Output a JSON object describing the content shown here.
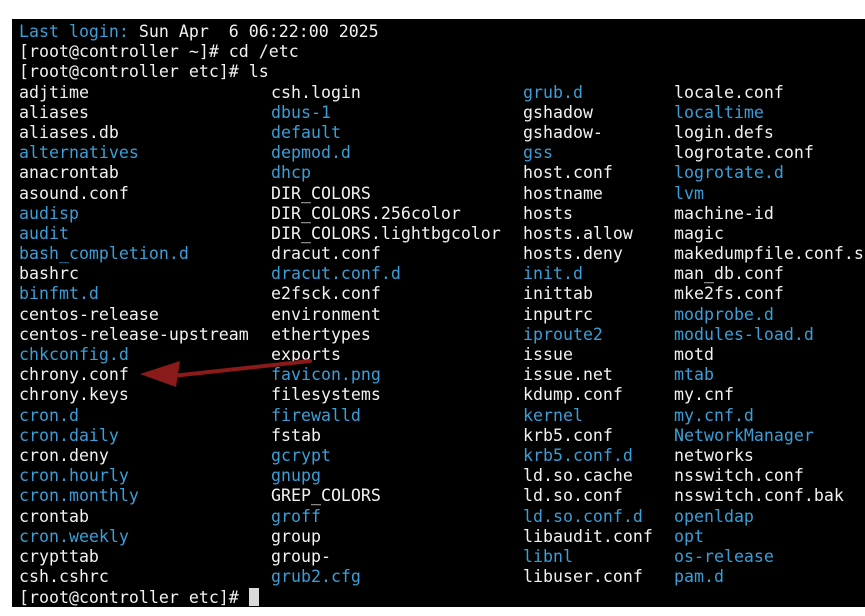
{
  "terminal": {
    "last_login_label": "Last login:",
    "last_login_value": " Sun Apr  6 06:22:00 2025",
    "cmd1": "[root@controller ~]# cd /etc",
    "cmd2": "[root@controller etc]# ls",
    "prompt_final": "[root@controller etc]# ",
    "columns": [
      [
        {
          "name": "adjtime",
          "type": "file"
        },
        {
          "name": "aliases",
          "type": "file"
        },
        {
          "name": "aliases.db",
          "type": "file"
        },
        {
          "name": "alternatives",
          "type": "dir"
        },
        {
          "name": "anacrontab",
          "type": "file"
        },
        {
          "name": "asound.conf",
          "type": "file"
        },
        {
          "name": "audisp",
          "type": "dir"
        },
        {
          "name": "audit",
          "type": "dir"
        },
        {
          "name": "bash_completion.d",
          "type": "dir"
        },
        {
          "name": "bashrc",
          "type": "file"
        },
        {
          "name": "binfmt.d",
          "type": "dir"
        },
        {
          "name": "centos-release",
          "type": "file"
        },
        {
          "name": "centos-release-upstream",
          "type": "file"
        },
        {
          "name": "chkconfig.d",
          "type": "dir"
        },
        {
          "name": "chrony.conf",
          "type": "file"
        },
        {
          "name": "chrony.keys",
          "type": "file"
        },
        {
          "name": "cron.d",
          "type": "dir"
        },
        {
          "name": "cron.daily",
          "type": "dir"
        },
        {
          "name": "cron.deny",
          "type": "file"
        },
        {
          "name": "cron.hourly",
          "type": "dir"
        },
        {
          "name": "cron.monthly",
          "type": "dir"
        },
        {
          "name": "crontab",
          "type": "file"
        },
        {
          "name": "cron.weekly",
          "type": "dir"
        },
        {
          "name": "crypttab",
          "type": "file"
        },
        {
          "name": "csh.cshrc",
          "type": "file"
        }
      ],
      [
        {
          "name": "csh.login",
          "type": "file"
        },
        {
          "name": "dbus-1",
          "type": "dir"
        },
        {
          "name": "default",
          "type": "dir"
        },
        {
          "name": "depmod.d",
          "type": "dir"
        },
        {
          "name": "dhcp",
          "type": "dir"
        },
        {
          "name": "DIR_COLORS",
          "type": "file"
        },
        {
          "name": "DIR_COLORS.256color",
          "type": "file"
        },
        {
          "name": "DIR_COLORS.lightbgcolor",
          "type": "file"
        },
        {
          "name": "dracut.conf",
          "type": "file"
        },
        {
          "name": "dracut.conf.d",
          "type": "dir"
        },
        {
          "name": "e2fsck.conf",
          "type": "file"
        },
        {
          "name": "environment",
          "type": "file"
        },
        {
          "name": "ethertypes",
          "type": "file"
        },
        {
          "name": "exports",
          "type": "file"
        },
        {
          "name": "favicon.png",
          "type": "dir"
        },
        {
          "name": "filesystems",
          "type": "file"
        },
        {
          "name": "firewalld",
          "type": "dir"
        },
        {
          "name": "fstab",
          "type": "file"
        },
        {
          "name": "gcrypt",
          "type": "dir"
        },
        {
          "name": "gnupg",
          "type": "dir"
        },
        {
          "name": "GREP_COLORS",
          "type": "file"
        },
        {
          "name": "groff",
          "type": "dir"
        },
        {
          "name": "group",
          "type": "file"
        },
        {
          "name": "group-",
          "type": "file"
        },
        {
          "name": "grub2.cfg",
          "type": "dir"
        }
      ],
      [
        {
          "name": "grub.d",
          "type": "dir"
        },
        {
          "name": "gshadow",
          "type": "file"
        },
        {
          "name": "gshadow-",
          "type": "file"
        },
        {
          "name": "gss",
          "type": "dir"
        },
        {
          "name": "host.conf",
          "type": "file"
        },
        {
          "name": "hostname",
          "type": "file"
        },
        {
          "name": "hosts",
          "type": "file"
        },
        {
          "name": "hosts.allow",
          "type": "file"
        },
        {
          "name": "hosts.deny",
          "type": "file"
        },
        {
          "name": "init.d",
          "type": "dir"
        },
        {
          "name": "inittab",
          "type": "file"
        },
        {
          "name": "inputrc",
          "type": "file"
        },
        {
          "name": "iproute2",
          "type": "dir"
        },
        {
          "name": "issue",
          "type": "file"
        },
        {
          "name": "issue.net",
          "type": "file"
        },
        {
          "name": "kdump.conf",
          "type": "file"
        },
        {
          "name": "kernel",
          "type": "dir"
        },
        {
          "name": "krb5.conf",
          "type": "file"
        },
        {
          "name": "krb5.conf.d",
          "type": "dir"
        },
        {
          "name": "ld.so.cache",
          "type": "file"
        },
        {
          "name": "ld.so.conf",
          "type": "file"
        },
        {
          "name": "ld.so.conf.d",
          "type": "dir"
        },
        {
          "name": "libaudit.conf",
          "type": "file"
        },
        {
          "name": "libnl",
          "type": "dir"
        },
        {
          "name": "libuser.conf",
          "type": "file"
        }
      ],
      [
        {
          "name": "locale.conf",
          "type": "file"
        },
        {
          "name": "localtime",
          "type": "dir"
        },
        {
          "name": "login.defs",
          "type": "file"
        },
        {
          "name": "logrotate.conf",
          "type": "file"
        },
        {
          "name": "logrotate.d",
          "type": "dir"
        },
        {
          "name": "lvm",
          "type": "dir"
        },
        {
          "name": "machine-id",
          "type": "file"
        },
        {
          "name": "magic",
          "type": "file"
        },
        {
          "name": "makedumpfile.conf.s",
          "type": "file"
        },
        {
          "name": "man_db.conf",
          "type": "file"
        },
        {
          "name": "mke2fs.conf",
          "type": "file"
        },
        {
          "name": "modprobe.d",
          "type": "dir"
        },
        {
          "name": "modules-load.d",
          "type": "dir"
        },
        {
          "name": "motd",
          "type": "file"
        },
        {
          "name": "mtab",
          "type": "dir"
        },
        {
          "name": "my.cnf",
          "type": "file"
        },
        {
          "name": "my.cnf.d",
          "type": "dir"
        },
        {
          "name": "NetworkManager",
          "type": "dir"
        },
        {
          "name": "networks",
          "type": "file"
        },
        {
          "name": "nsswitch.conf",
          "type": "file"
        },
        {
          "name": "nsswitch.conf.bak",
          "type": "file"
        },
        {
          "name": "openldap",
          "type": "dir"
        },
        {
          "name": "opt",
          "type": "dir"
        },
        {
          "name": "os-release",
          "type": "dir"
        },
        {
          "name": "pam.d",
          "type": "dir"
        }
      ]
    ]
  },
  "colors": {
    "background": "#000000",
    "text": "#f2f2f2",
    "directory": "#3a9fd8",
    "annotation_arrow": "#8b1a1a"
  },
  "annotation": {
    "arrow_icon": "arrow-left-icon",
    "points_to": "chrony.conf"
  }
}
